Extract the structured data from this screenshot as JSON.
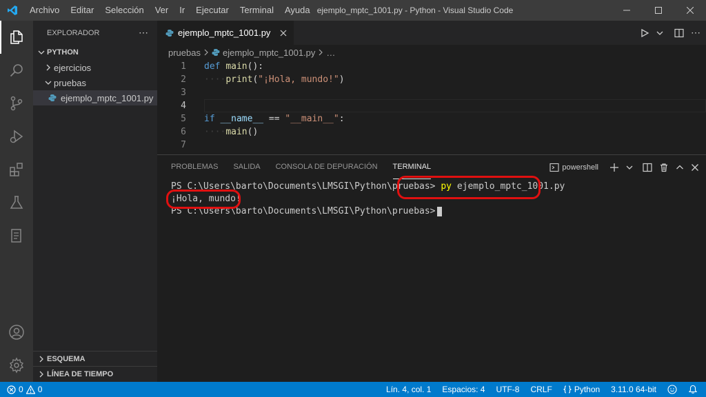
{
  "titlebar": {
    "menu": [
      "Archivo",
      "Editar",
      "Selección",
      "Ver",
      "Ir",
      "Ejecutar",
      "Terminal",
      "Ayuda"
    ],
    "window_title": "ejemplo_mptc_1001.py - Python - Visual Studio Code"
  },
  "sidebar": {
    "header": "EXPLORADOR",
    "project": "PYTHON",
    "tree": [
      {
        "label": "ejercicios",
        "type": "folder",
        "expanded": false
      },
      {
        "label": "pruebas",
        "type": "folder",
        "expanded": true
      },
      {
        "label": "ejemplo_mptc_1001.py",
        "type": "file",
        "selected": true
      }
    ],
    "outline": "ESQUEMA",
    "timeline": "LÍNEA DE TIEMPO"
  },
  "editor": {
    "tab_label": "ejemplo_mptc_1001.py",
    "breadcrumb": {
      "folder": "pruebas",
      "file": "ejemplo_mptc_1001.py",
      "more": "…"
    },
    "line_numbers": [
      "1",
      "2",
      "3",
      "4",
      "5",
      "6",
      "7"
    ],
    "code": {
      "l1_kw": "def",
      "l1_fn": "main",
      "l1_rest": "():",
      "l2_fn": "print",
      "l2_open": "(",
      "l2_str": "\"¡Hola, mundo!\"",
      "l2_close": ")",
      "l5_kw": "if",
      "l5_var": "__name__",
      "l5_op": " == ",
      "l5_str": "\"__main__\"",
      "l5_colon": ":",
      "l6_fn": "main",
      "l6_rest": "()"
    },
    "current_line": 4
  },
  "panel": {
    "tabs": [
      "PROBLEMAS",
      "SALIDA",
      "CONSOLA DE DEPURACIÓN",
      "TERMINAL"
    ],
    "active_tab": "TERMINAL",
    "shell": "powershell",
    "terminal": {
      "prompt1": "PS C:\\Users\\barto\\Documents\\LMSGI\\Python\\pruebas>",
      "cmd_name": "py",
      "cmd_args": " ejemplo_mptc_1001.py",
      "output": "¡Hola, mundo!",
      "prompt2": "PS C:\\Users\\barto\\Documents\\LMSGI\\Python\\pruebas>"
    }
  },
  "statusbar": {
    "errors": "0",
    "warnings": "0",
    "position": "Lín. 4, col. 1",
    "spaces": "Espacios: 4",
    "encoding": "UTF-8",
    "eol": "CRLF",
    "language": "Python",
    "interpreter": "3.11.0 64-bit"
  },
  "colors": {
    "accent": "#007acc",
    "highlight_ring": "#e01010"
  }
}
